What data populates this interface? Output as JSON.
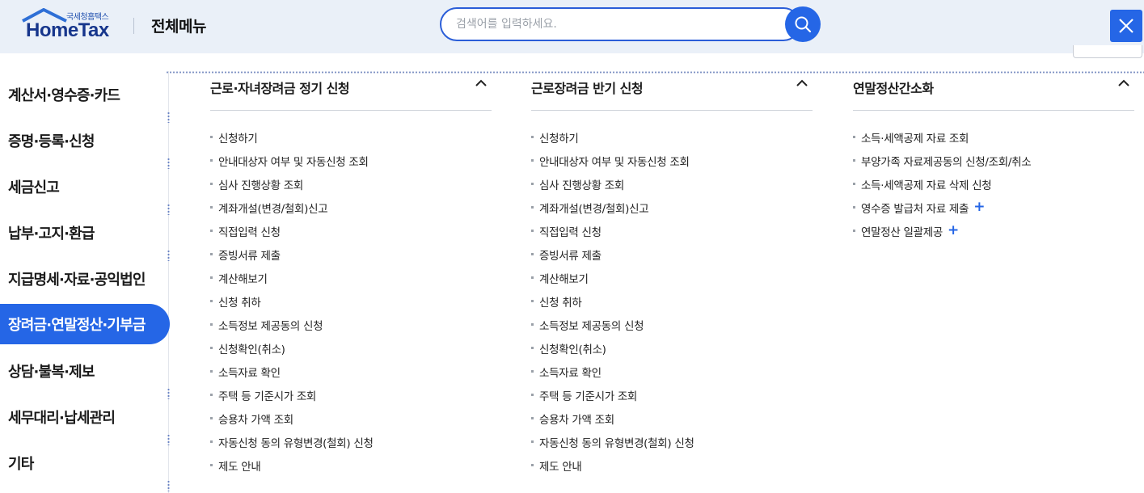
{
  "header": {
    "logo_sub": "국세청홈택스",
    "logo_main": "HomeTax",
    "title": "전체메뉴",
    "search_placeholder": "검색어를 입력하세요."
  },
  "sidebar": {
    "items": [
      {
        "label": "계산서·영수증·카드"
      },
      {
        "label": "증명·등록·신청"
      },
      {
        "label": "세금신고"
      },
      {
        "label": "납부·고지·환급"
      },
      {
        "label": "지급명세·자료·공익법인"
      },
      {
        "label": "장려금·연말정산·기부금",
        "active": true
      },
      {
        "label": "상담·불복·제보"
      },
      {
        "label": "세무대리·납세관리"
      },
      {
        "label": "기타"
      }
    ]
  },
  "columns": [
    {
      "title": "근로·자녀장려금 정기 신청",
      "items": [
        {
          "label": "신청하기"
        },
        {
          "label": "안내대상자 여부 및 자동신청 조회"
        },
        {
          "label": "심사 진행상황 조회"
        },
        {
          "label": "계좌개설(변경/철회)신고"
        },
        {
          "label": "직접입력 신청"
        },
        {
          "label": "증빙서류 제출"
        },
        {
          "label": "계산해보기"
        },
        {
          "label": "신청 취하"
        },
        {
          "label": "소득정보 제공동의 신청"
        },
        {
          "label": "신청확인(취소)"
        },
        {
          "label": "소득자료 확인"
        },
        {
          "label": "주택 등 기준시가 조회"
        },
        {
          "label": "승용차 가액 조회"
        },
        {
          "label": "자동신청 동의 유형변경(철회) 신청"
        },
        {
          "label": "제도 안내"
        }
      ]
    },
    {
      "title": "근로장려금 반기 신청",
      "items": [
        {
          "label": "신청하기"
        },
        {
          "label": "안내대상자 여부 및 자동신청 조회"
        },
        {
          "label": "심사 진행상황 조회"
        },
        {
          "label": "계좌개설(변경/철회)신고"
        },
        {
          "label": "직접입력 신청"
        },
        {
          "label": "증빙서류 제출"
        },
        {
          "label": "계산해보기"
        },
        {
          "label": "신청 취하"
        },
        {
          "label": "소득정보 제공동의 신청"
        },
        {
          "label": "신청확인(취소)"
        },
        {
          "label": "소득자료 확인"
        },
        {
          "label": "주택 등 기준시가 조회"
        },
        {
          "label": "승용차 가액 조회"
        },
        {
          "label": "자동신청 동의 유형변경(철회) 신청"
        },
        {
          "label": "제도 안내"
        }
      ]
    },
    {
      "title": "연말정산간소화",
      "items": [
        {
          "label": "소득·세액공제 자료 조회"
        },
        {
          "label": "부양가족 자료제공동의 신청/조회/취소"
        },
        {
          "label": "소득·세액공제 자료 삭제 신청"
        },
        {
          "label": "영수증 발급처 자료 제출",
          "plus": "+"
        },
        {
          "label": "연말정산 일괄제공",
          "plus": "+"
        }
      ]
    }
  ],
  "colors": {
    "accent": "#2566e6",
    "header_bg": "#eaf0f8",
    "logo": "#17368c"
  },
  "icons": {
    "search": "search-icon",
    "close": "close-icon",
    "collapse": "chevron-up-icon",
    "expand": "plus-icon"
  }
}
